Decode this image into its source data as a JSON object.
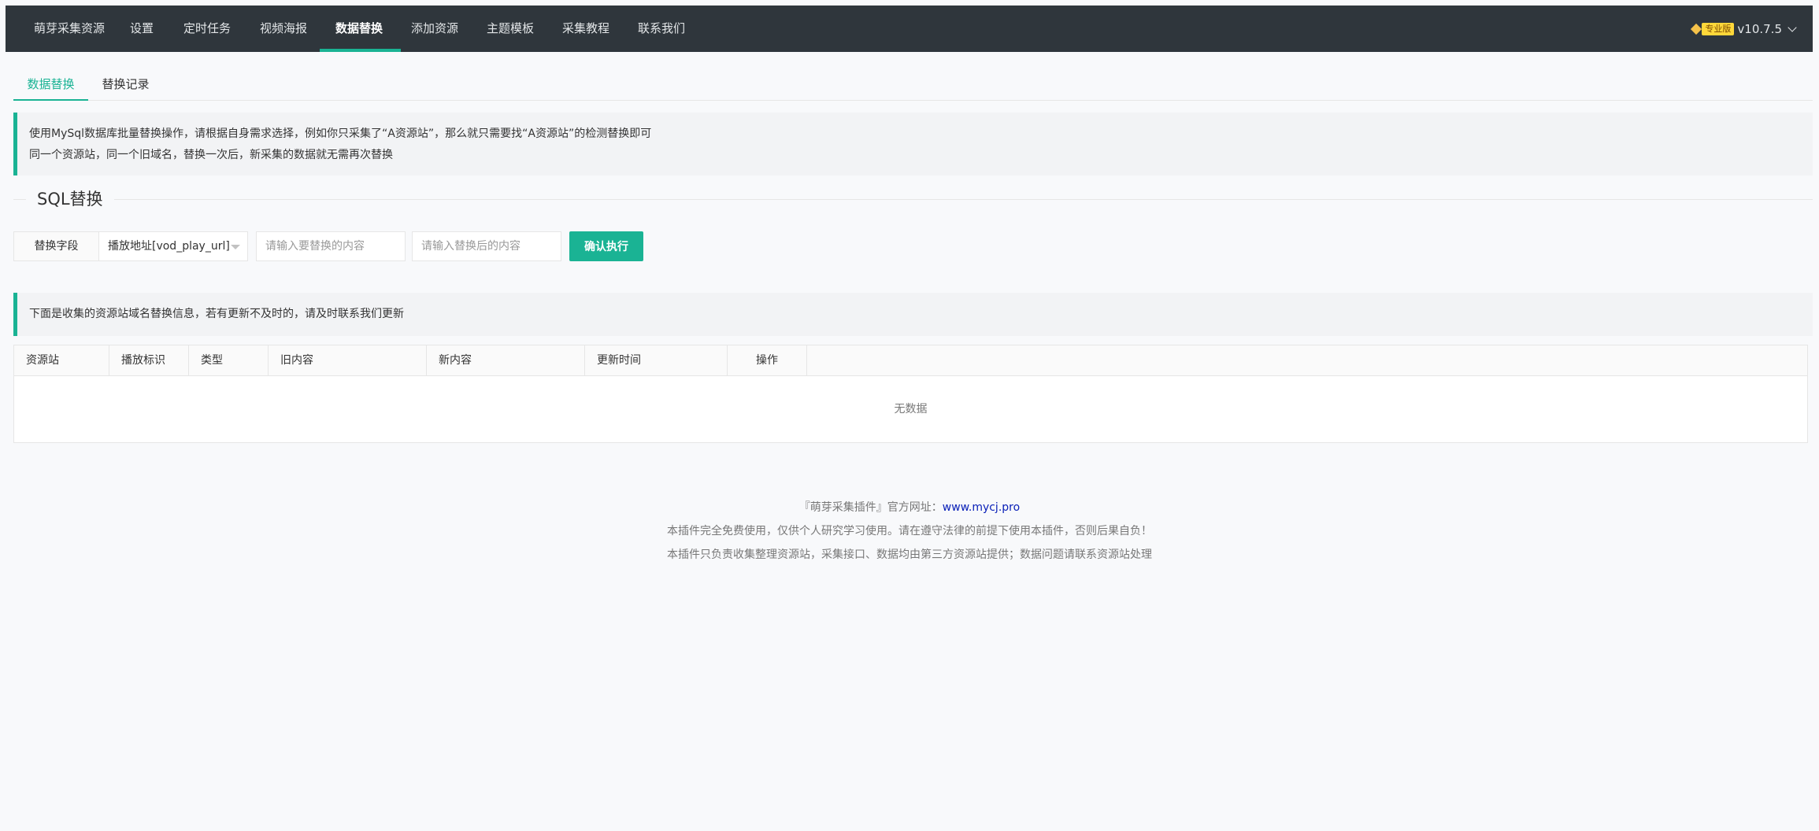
{
  "nav": {
    "items": [
      {
        "label": "萌芽采集资源"
      },
      {
        "label": "设置"
      },
      {
        "label": "定时任务"
      },
      {
        "label": "视频海报"
      },
      {
        "label": "数据替换"
      },
      {
        "label": "添加资源"
      },
      {
        "label": "主题模板"
      },
      {
        "label": "采集教程"
      },
      {
        "label": "联系我们"
      }
    ],
    "active_index": 4,
    "badge": "专业版",
    "version": "v10.7.5"
  },
  "subtabs": [
    {
      "label": "数据替换"
    },
    {
      "label": "替换记录"
    }
  ],
  "notice_top": {
    "line1": "使用MySql数据库批量替换操作，请根据自身需求选择，例如你只采集了“A资源站”，那么就只需要找“A资源站”的检测替换即可",
    "line2": "同一个资源站，同一个旧域名，替换一次后，新采集的数据就无需再次替换"
  },
  "section_title": "SQL替换",
  "form": {
    "field_label": "替换字段",
    "field_selected": "播放地址[vod_play_url]",
    "old_placeholder": "请输入要替换的内容",
    "new_placeholder": "请输入替换后的内容",
    "submit_label": "确认执行"
  },
  "notice_list": "下面是收集的资源站域名替换信息，若有更新不及时的，请及时联系我们更新",
  "table": {
    "columns": [
      "资源站",
      "播放标识",
      "类型",
      "旧内容",
      "新内容",
      "更新时间",
      "操作"
    ],
    "rows": [],
    "empty_text": "无数据"
  },
  "footer": {
    "line1_prefix": "『萌芽采集插件』官方网址：",
    "line1_link": "www.mycj.pro",
    "line2": "本插件完全免费使用，仅供个人研究学习使用。请在遵守法律的前提下使用本插件，否则后果自负！",
    "line3": "本插件只负责收集整理资源站，采集接口、数据均由第三方资源站提供；数据问题请联系资源站处理"
  },
  "colors": {
    "nav_bg": "#2f363c",
    "accent": "#1ab394",
    "badge": "#ffd83a",
    "link": "#0b21b8"
  }
}
